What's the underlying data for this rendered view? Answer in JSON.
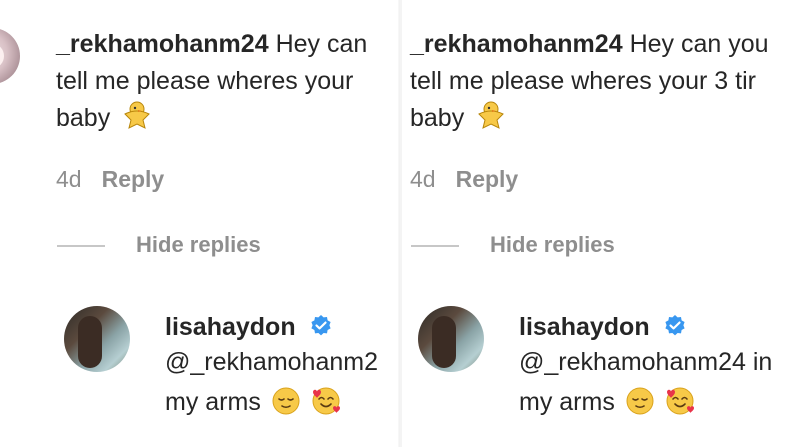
{
  "comment": {
    "username": "_rekhamohanm24",
    "text_left_line1": "Hey can",
    "text_left_line2": "tell me please wheres your",
    "text_right_line1": "Hey can you",
    "text_right_line2": "tell me please wheres your 3 tir",
    "text_line3": "baby",
    "emoji_icon": "chick-emoji-icon",
    "age": "4d",
    "reply_label": "Reply",
    "hide_replies_label": "Hide replies"
  },
  "reply": {
    "username": "lisahaydon",
    "verified_icon": "verified-badge-icon",
    "mention_left": "@_rekhamohanm2",
    "mention_right": "@_rekhamohanm24 in",
    "line2": "my arms",
    "emoji1_icon": "relieved-face-icon",
    "emoji2_icon": "smiling-face-with-hearts-icon"
  },
  "colors": {
    "text": "#262626",
    "muted": "#8e8e8e",
    "verified": "#3897f0",
    "emoji": "#f7c948"
  }
}
